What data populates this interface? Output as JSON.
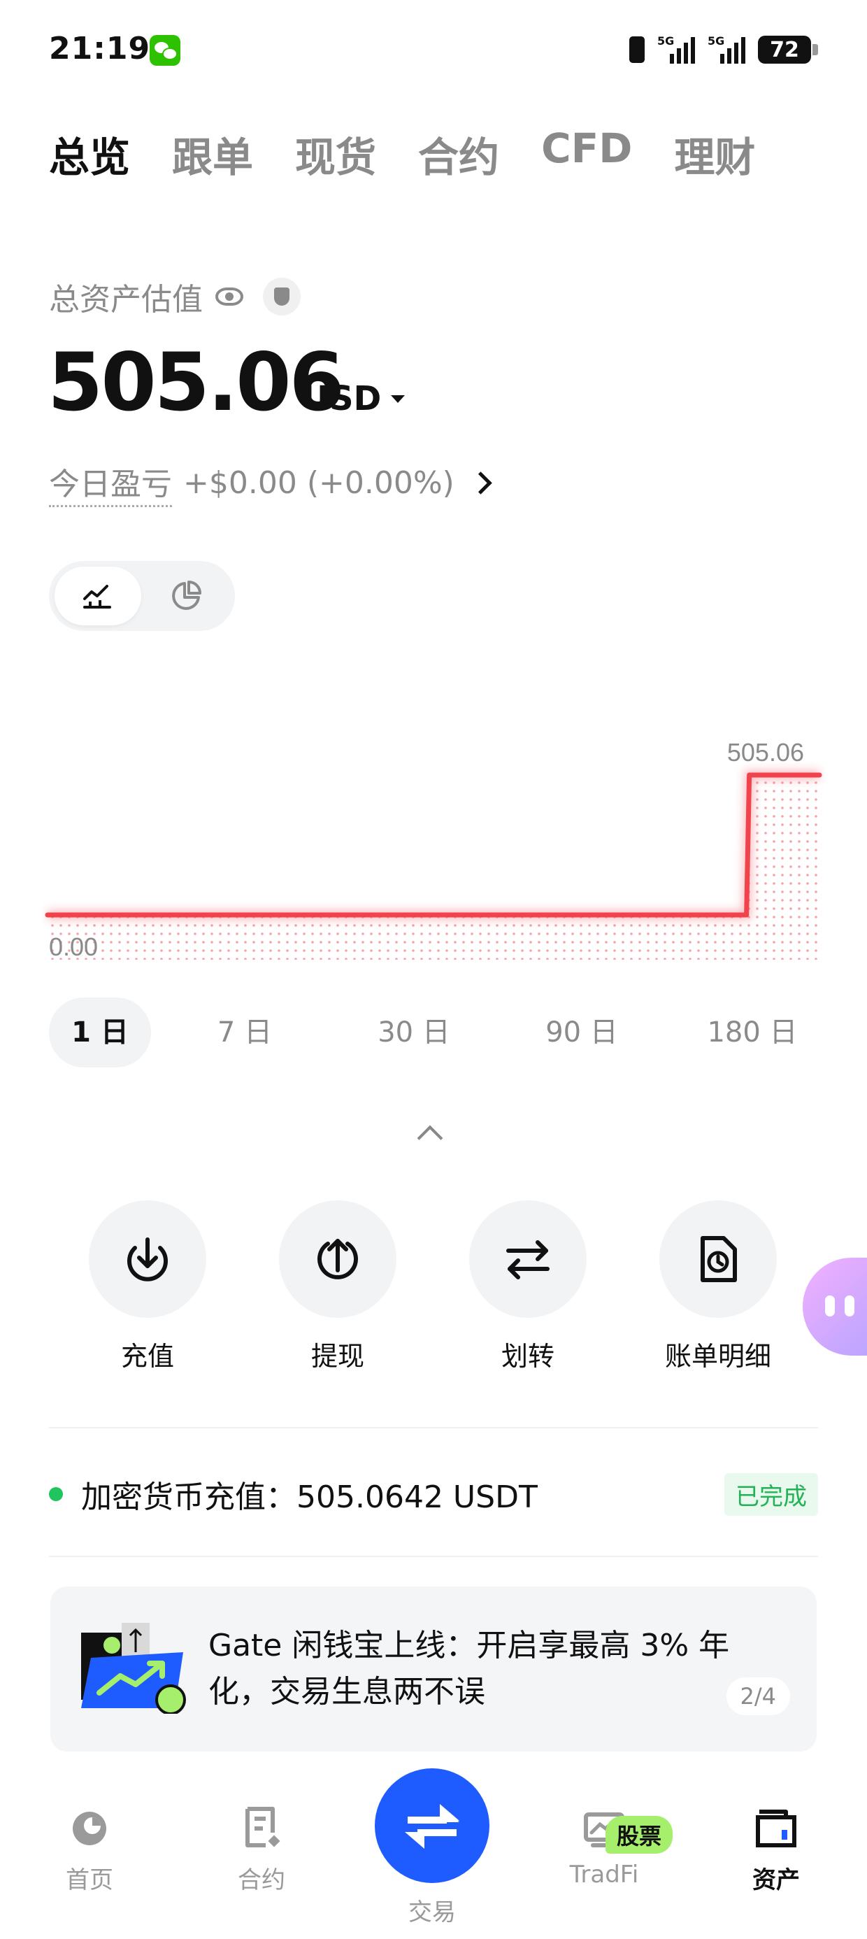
{
  "status_bar": {
    "time": "21:19",
    "battery": "72"
  },
  "tabs": [
    {
      "label": "总览",
      "active": true
    },
    {
      "label": "跟单",
      "active": false
    },
    {
      "label": "现货",
      "active": false
    },
    {
      "label": "合约",
      "active": false
    },
    {
      "label": "CFD",
      "active": false
    },
    {
      "label": "理财",
      "active": false
    }
  ],
  "assets": {
    "label": "总资产估值",
    "total": "505.06",
    "currency": "USD",
    "pnl_label": "今日盈亏",
    "pnl_value": "+$0.00 (+0.00%)"
  },
  "chart_data": {
    "type": "line",
    "max_label": "505.06",
    "min_label": "0.00",
    "series": [
      {
        "values": [
          0,
          0,
          0,
          0,
          0,
          0,
          0,
          0,
          0,
          0,
          505.06,
          505.06
        ]
      }
    ],
    "color": "#f0434c"
  },
  "ranges": [
    {
      "label": "1 日",
      "active": true
    },
    {
      "label": "7 日",
      "active": false
    },
    {
      "label": "30 日",
      "active": false
    },
    {
      "label": "90 日",
      "active": false
    },
    {
      "label": "180 日",
      "active": false
    }
  ],
  "actions": [
    {
      "label": "充值",
      "icon": "deposit-icon"
    },
    {
      "label": "提现",
      "icon": "withdraw-icon"
    },
    {
      "label": "划转",
      "icon": "transfer-icon"
    },
    {
      "label": "账单明细",
      "icon": "bill-icon"
    }
  ],
  "notice": {
    "text": "加密货币充值：505.0642 USDT",
    "status": "已完成"
  },
  "banner": {
    "text": "Gate 闲钱宝上线：开启享最高 3% 年化，交易生息两不误",
    "page": "2/4"
  },
  "bottom_nav": {
    "home": "首页",
    "futures": "合约",
    "trade": "交易",
    "tradfi": "TradFi",
    "tradfi_badge": "股票",
    "assets": "资产"
  }
}
